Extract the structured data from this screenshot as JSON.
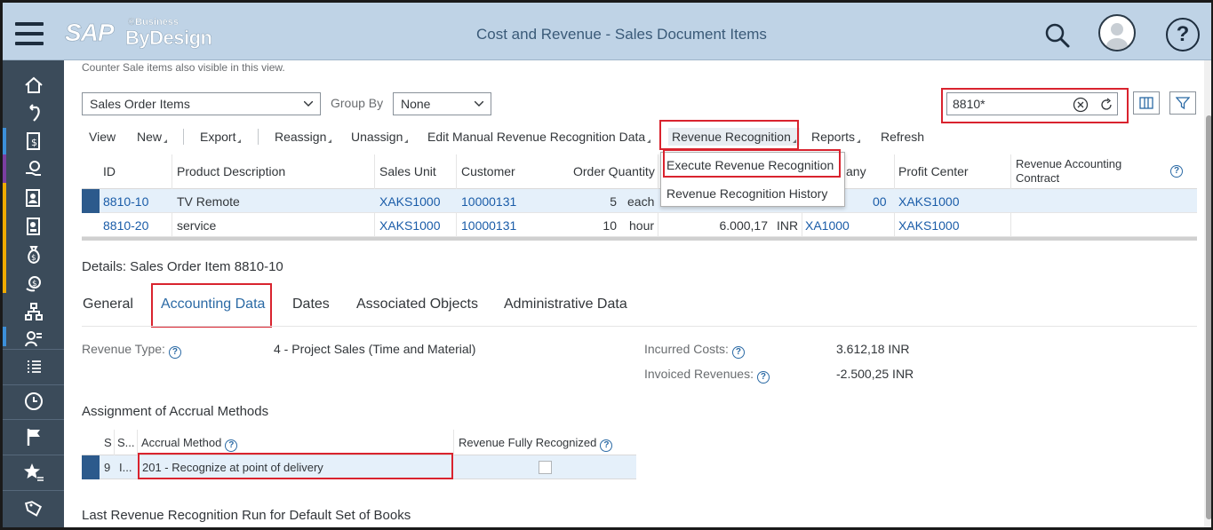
{
  "header": {
    "logo_sap": "SAP",
    "logo_business": "®Business",
    "logo_bydesign": "ByDesign",
    "title": "Cost and Revenue - Sales Document Items"
  },
  "sidebar": {
    "items": [
      {
        "icon": "home-icon"
      },
      {
        "icon": "refresh-arrow-icon"
      },
      {
        "icon": "document-money-icon"
      },
      {
        "icon": "hand-coin-icon"
      },
      {
        "icon": "person-document-icon"
      },
      {
        "icon": "contact-card-icon"
      },
      {
        "icon": "money-bag-icon"
      },
      {
        "icon": "coin-flow-icon"
      },
      {
        "icon": "org-chart-icon"
      },
      {
        "icon": "person-list-icon"
      },
      {
        "icon": "list-icon"
      },
      {
        "icon": "clock-icon"
      },
      {
        "icon": "flag-icon"
      },
      {
        "icon": "star-list-icon"
      },
      {
        "icon": "tags-icon"
      }
    ],
    "stripe_colors": [
      "#3c8fd9",
      "#7b3fa0",
      "#f0ab00",
      "#3c8fd9"
    ]
  },
  "note": "Counter Sale items also visible in this view.",
  "filters": {
    "view_select": "Sales Order Items",
    "group_by_label": "Group By",
    "group_by_value": "None",
    "search_value": "8810*"
  },
  "toolbar": {
    "view": "View",
    "new": "New",
    "export": "Export",
    "reassign": "Reassign",
    "unassign": "Unassign",
    "edit_manual": "Edit Manual Revenue Recognition Data",
    "revenue_recognition": "Revenue Recognition",
    "reports": "Reports",
    "refresh": "Refresh"
  },
  "dropdown": {
    "items": [
      "Execute Revenue Recognition",
      "Revenue Recognition History"
    ]
  },
  "table": {
    "columns": {
      "id": "ID",
      "product": "Product Description",
      "sales_unit": "Sales Unit",
      "customer": "Customer",
      "order_qty": "Order Quantity",
      "company": "any",
      "profit_center": "Profit Center",
      "rev_contract_1": "Revenue Accounting",
      "rev_contract_2": "Contract"
    },
    "rows": [
      {
        "id": "8810-10",
        "product": "TV Remote",
        "sales_unit": "XAKS1000",
        "customer": "10000131",
        "qty": "5",
        "unit": "each",
        "amount": "",
        "currency": "",
        "company": "00",
        "profit_center": "XAKS1000"
      },
      {
        "id": "8810-20",
        "product": "service",
        "sales_unit": "XAKS1000",
        "customer": "10000131",
        "qty": "10",
        "unit": "hour",
        "amount": "6.000,17",
        "currency": "INR",
        "company": "XA1000",
        "profit_center": "XAKS1000"
      }
    ]
  },
  "details": {
    "title": "Details: Sales Order Item 8810-10",
    "tabs": [
      "General",
      "Accounting Data",
      "Dates",
      "Associated Objects",
      "Administrative Data"
    ],
    "revenue_type_label": "Revenue Type:",
    "revenue_type_value": "4 - Project Sales (Time and Material)",
    "incurred_costs_label": "Incurred Costs:",
    "incurred_costs_value": "3.612,18 INR",
    "invoiced_revenues_label": "Invoiced Revenues:",
    "invoiced_revenues_value": "-2.500,25 INR",
    "accrual_title": "Assignment of Accrual Methods",
    "accrual_columns": {
      "s1": "S",
      "s2": "S...",
      "method": "Accrual Method",
      "fully": "Revenue Fully Recognized"
    },
    "accrual_row": {
      "s1": "9",
      "s2": "I...",
      "method": "201 - Recognize at point of delivery"
    },
    "last_run_title": "Last Revenue Recognition Run for Default Set of Books"
  },
  "help_glyph": "?",
  "colors": {
    "header_bg": "#bfd3e6",
    "sidebar_bg": "#3b4b5a",
    "link": "#1a5ca8",
    "highlight_box": "#d9232e",
    "selected_row": "#e5f0fa"
  }
}
